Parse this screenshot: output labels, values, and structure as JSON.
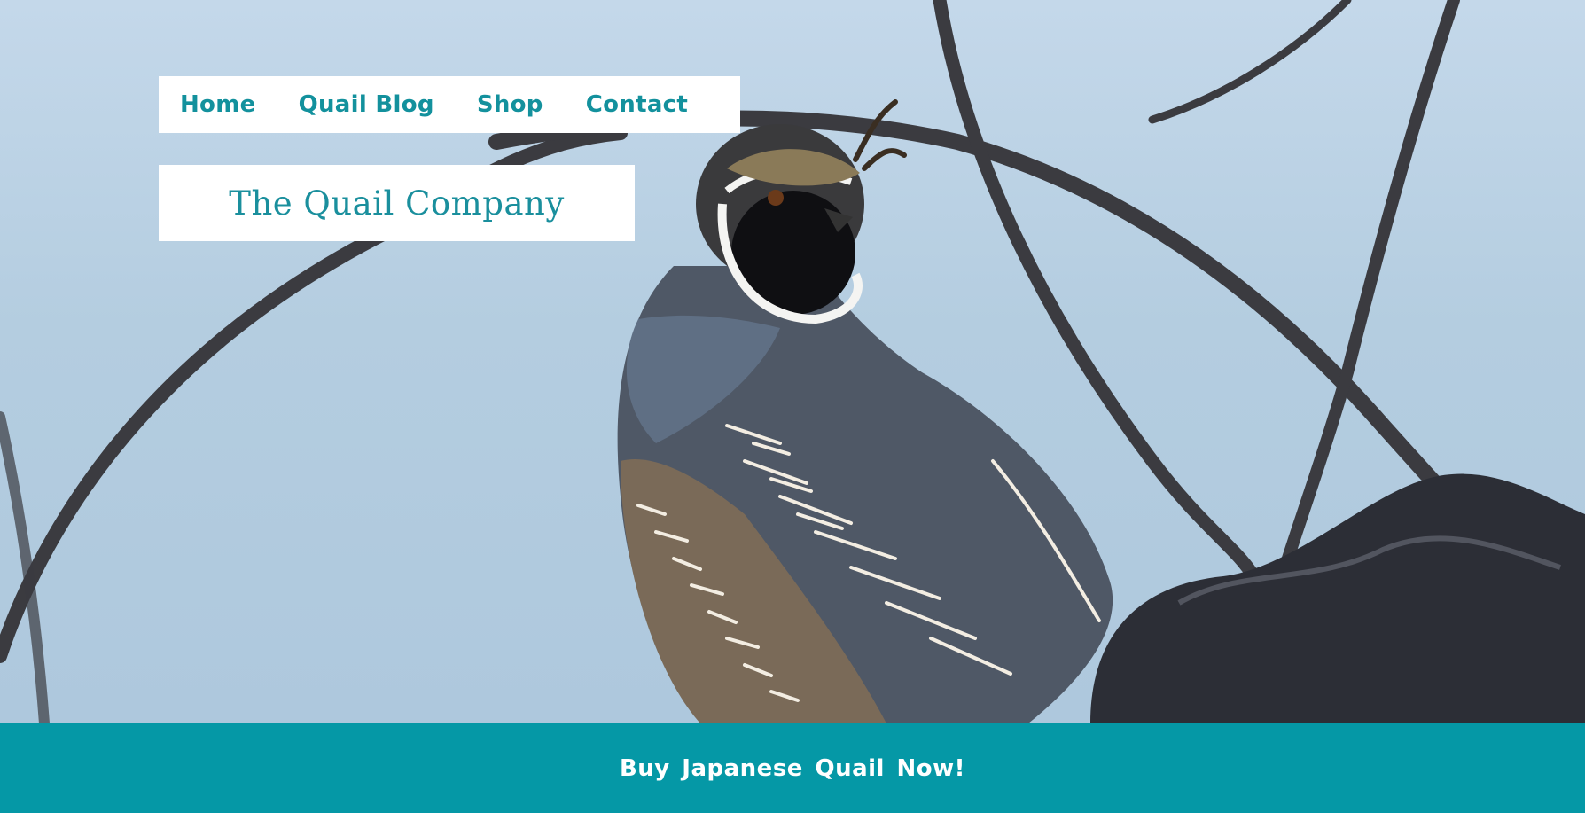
{
  "nav": {
    "items": [
      {
        "label": "Home"
      },
      {
        "label": "Quail Blog"
      },
      {
        "label": "Shop"
      },
      {
        "label": "Contact"
      }
    ]
  },
  "header": {
    "brand": "The Quail Company"
  },
  "hero": {
    "image": "quail-on-branch-photo"
  },
  "cta": {
    "label": "Buy Japanese Quail Now!"
  },
  "colors": {
    "accent": "#0598a6",
    "nav_text": "#13919d",
    "sky": "#b4cde0"
  }
}
